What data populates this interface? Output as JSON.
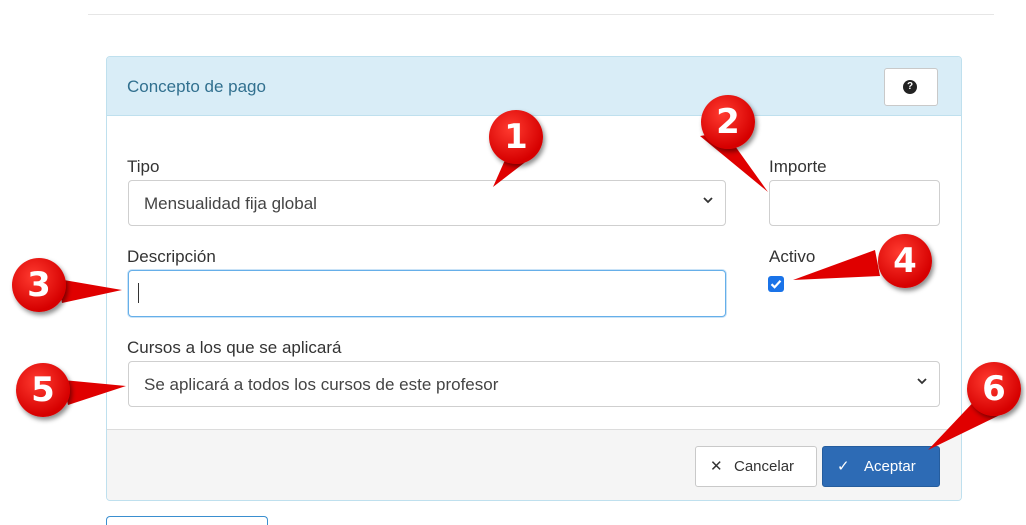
{
  "panel": {
    "title": "Concepto de pago",
    "help_icon": "question-circle-icon",
    "help_glyph": "?"
  },
  "form": {
    "tipo": {
      "label": "Tipo",
      "value": "Mensualidad fija global"
    },
    "importe": {
      "label": "Importe",
      "value": ""
    },
    "descripcion": {
      "label": "Descripción",
      "value": ""
    },
    "activo": {
      "label": "Activo",
      "checked": true
    },
    "cursos": {
      "label": "Cursos a los que se aplicará",
      "value": "Se aplicará a todos los cursos de este profesor"
    }
  },
  "footer": {
    "cancel": {
      "icon": "close-icon",
      "glyph": "✕",
      "label": "Cancelar"
    },
    "accept": {
      "icon": "check-icon",
      "glyph": "✓",
      "label": "Aceptar"
    }
  },
  "annotations": {
    "color": "#e00000",
    "markers": [
      "1",
      "2",
      "3",
      "4",
      "5",
      "6"
    ]
  },
  "colors": {
    "panel_header_bg": "#d9edf7",
    "panel_title": "#31708f",
    "primary_button": "#2d6bb5",
    "checkbox": "#1a73e8"
  }
}
